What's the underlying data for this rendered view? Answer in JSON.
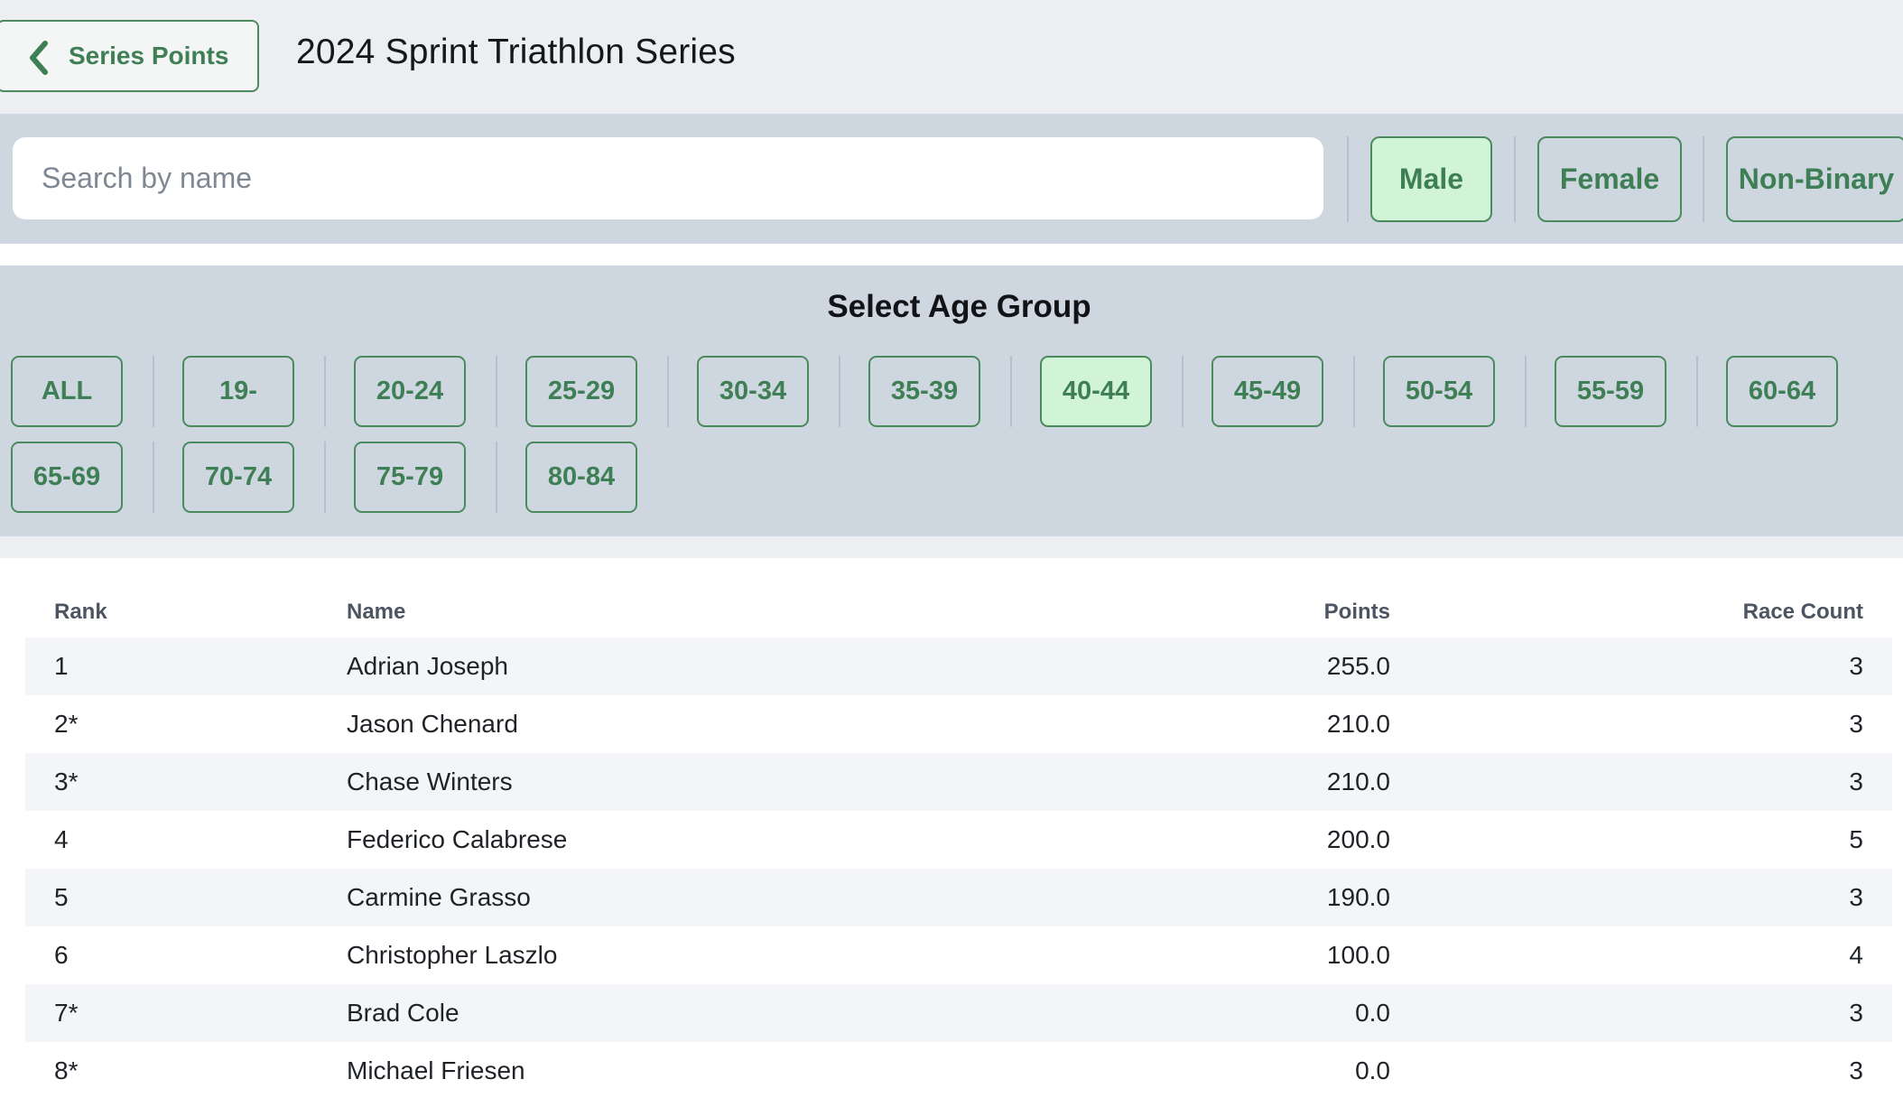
{
  "header": {
    "back_label": "Series Points",
    "title": "2024 Sprint Triathlon Series"
  },
  "search": {
    "placeholder": "Search by name",
    "value": ""
  },
  "gender_filters": [
    {
      "label": "Male",
      "selected": true
    },
    {
      "label": "Female",
      "selected": false
    },
    {
      "label": "Non-Binary",
      "selected": false
    }
  ],
  "age_groups": {
    "heading": "Select Age Group",
    "options": [
      "ALL",
      "19-",
      "20-24",
      "25-29",
      "30-34",
      "35-39",
      "40-44",
      "45-49",
      "50-54",
      "55-59",
      "60-64",
      "65-69",
      "70-74",
      "75-79",
      "80-84"
    ],
    "selected": "40-44"
  },
  "table": {
    "columns": {
      "rank": "Rank",
      "name": "Name",
      "points": "Points",
      "races": "Race Count"
    },
    "rows": [
      {
        "rank": "1",
        "name": "Adrian Joseph",
        "points": "255.0",
        "races": "3"
      },
      {
        "rank": "2*",
        "name": "Jason Chenard",
        "points": "210.0",
        "races": "3"
      },
      {
        "rank": "3*",
        "name": "Chase Winters",
        "points": "210.0",
        "races": "3"
      },
      {
        "rank": "4",
        "name": "Federico Calabrese",
        "points": "200.0",
        "races": "5"
      },
      {
        "rank": "5",
        "name": "Carmine Grasso",
        "points": "190.0",
        "races": "3"
      },
      {
        "rank": "6",
        "name": "Christopher Laszlo",
        "points": "100.0",
        "races": "4"
      },
      {
        "rank": "7*",
        "name": "Brad Cole",
        "points": "0.0",
        "races": "3"
      },
      {
        "rank": "8*",
        "name": "Michael Friesen",
        "points": "0.0",
        "races": "3"
      }
    ]
  },
  "colors": {
    "accent_green": "#3f7f55",
    "selected_bg": "#d2f4d6",
    "filter_bg": "#ced6e0"
  }
}
